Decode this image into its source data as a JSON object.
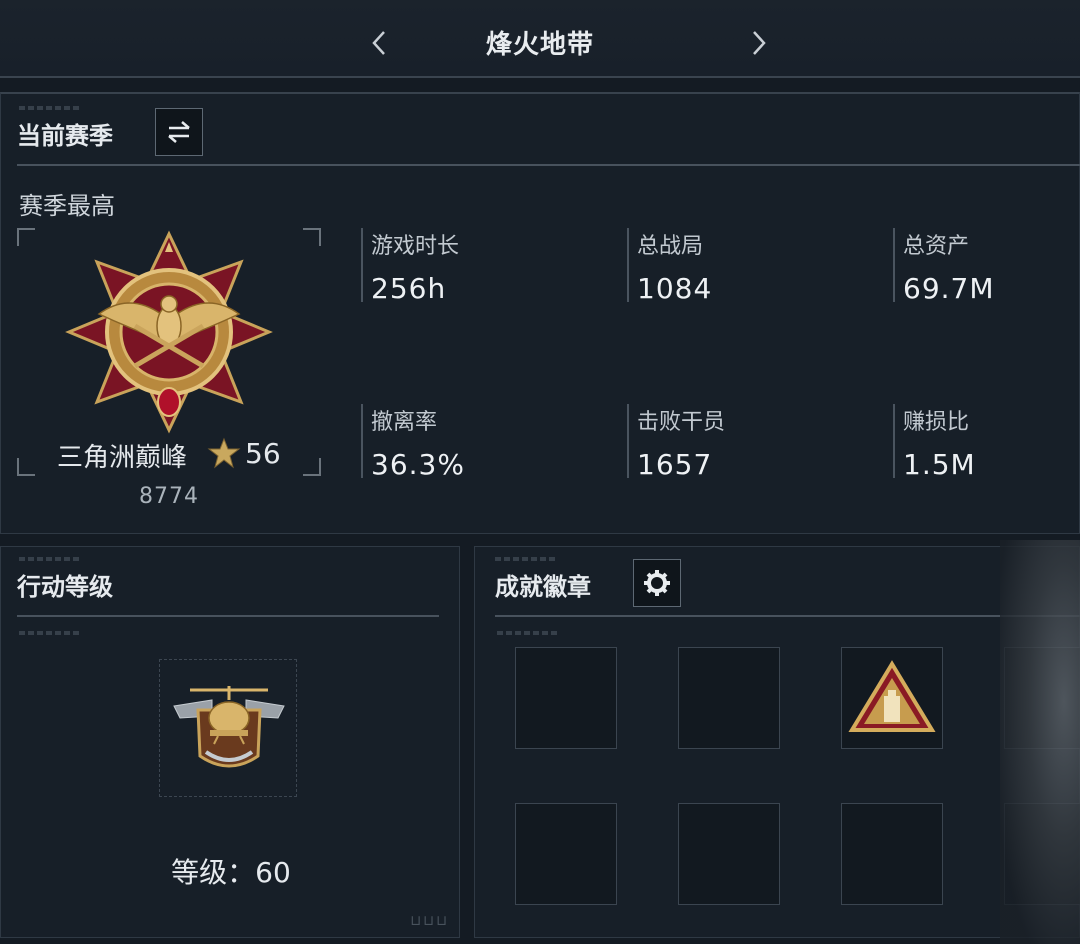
{
  "header": {
    "title": "烽火地带",
    "prev_icon": "chevron-left-icon",
    "next_icon": "chevron-right-icon"
  },
  "season": {
    "title": "当前赛季",
    "switch_icon": "swap-arrows-icon",
    "subtitle": "赛季最高",
    "rank": {
      "name": "三角洲巅峰",
      "star_icon": "star-icon",
      "stars": "56",
      "score": "8774"
    },
    "stats": [
      {
        "label": "游戏时长",
        "value": "256h"
      },
      {
        "label": "总战局",
        "value": "1084"
      },
      {
        "label": "总资产",
        "value": "69.7M"
      },
      {
        "label": "撤离率",
        "value": "36.3%"
      },
      {
        "label": "击败干员",
        "value": "1657"
      },
      {
        "label": "赚损比",
        "value": "1.5M"
      }
    ]
  },
  "action_level": {
    "title": "行动等级",
    "emblem_icon": "helicopter-emblem-icon",
    "level_text": "等级：60"
  },
  "achievements": {
    "title": "成就徽章",
    "settings_icon": "gear-icon",
    "badge_icon": "pyramid-badge-icon"
  },
  "colors": {
    "background": "#141b23",
    "panel": "#182029",
    "gold": "#c9a35a",
    "crimson": "#8e1b2a"
  }
}
